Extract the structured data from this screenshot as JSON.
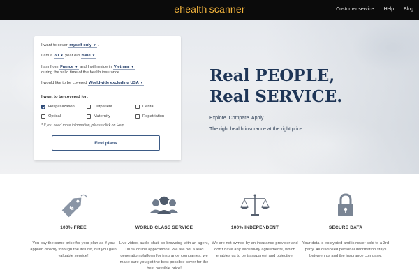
{
  "brand": {
    "logo_e": "e",
    "logo_health": "health",
    "logo_scanner": "scanner"
  },
  "nav": {
    "items": [
      "Customer service",
      "Help",
      "Blog"
    ]
  },
  "form": {
    "cover_prefix": "I want to cover",
    "cover_value": "myself only",
    "age_prefix": "I am a",
    "age_value": "30",
    "age_mid": "year old",
    "gender_value": "male",
    "from_prefix": "I am from",
    "country_value": "France",
    "reside_mid": "and I will reside in",
    "residence_value": "Vietnam",
    "during_text": "during the valid time of the health insurance.",
    "coverage_prefix": "I would like to be covered",
    "coverage_value": "Worldwide excluding USA",
    "covered_for_title": "I want to be covered for:",
    "options": [
      {
        "label": "Hospitalization",
        "checked": true
      },
      {
        "label": "Outpatient",
        "checked": false
      },
      {
        "label": "Dental",
        "checked": false
      },
      {
        "label": "Optical",
        "checked": false
      },
      {
        "label": "Maternity",
        "checked": false
      },
      {
        "label": "Repatriation",
        "checked": false
      }
    ],
    "hint": "* If you need more information, please click on Help.",
    "submit_label": "Find plans"
  },
  "hero": {
    "headline_line1": "Real PEOPLE,",
    "headline_line2": "Real SERVICE.",
    "tagline1": "Explore. Compare. Apply.",
    "tagline2": "The right health insurance at the right price."
  },
  "features": [
    {
      "icon": "price-tag-icon",
      "title": "100% FREE",
      "desc": "You pay the same price for your plan as if you applied directly through the insurer, but you gain valuable service!"
    },
    {
      "icon": "support-team-icon",
      "title": "WORLD CLASS SERVICE",
      "desc": "Live video, audio chat, co-browsing with an agent, 100% online applications. We are not a lead generation platform for insurance companies, we make sure you get the best possible cover for the best possible price!"
    },
    {
      "icon": "scales-icon",
      "title": "100% INDEPENDENT",
      "desc": "We are not owned by an insurance provider and don't have any exclusivity agreements, which enables us to be transparent and objective."
    },
    {
      "icon": "padlock-icon",
      "title": "SECURE DATA",
      "desc": "Your data is encrypted and is never sold to a 3rd party. All disclosed personal information stays between us and the insurance company."
    }
  ],
  "colors": {
    "accent": "#f2b33d",
    "navy": "#1e3556",
    "icon_gray": "#7a8594",
    "topbar": "#0b0b0b"
  }
}
